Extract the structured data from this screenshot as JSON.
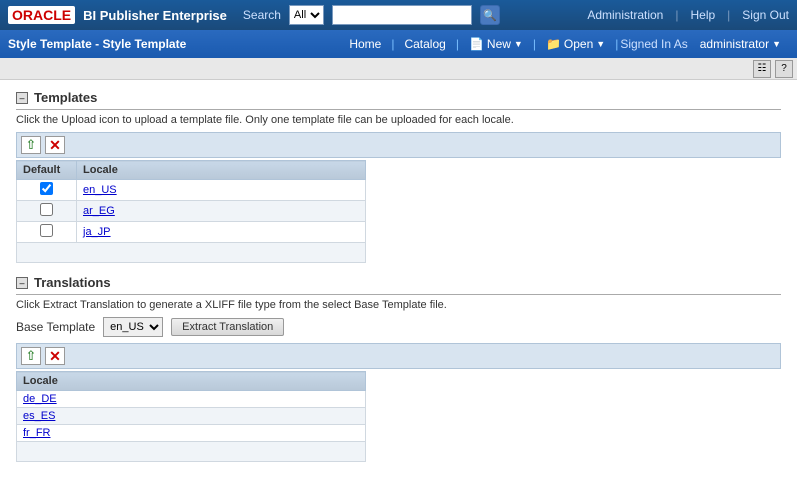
{
  "app": {
    "oracle_label": "ORACLE",
    "app_title": "BI Publisher Enterprise",
    "search_label": "Search",
    "search_value": "",
    "search_options": [
      "All"
    ],
    "search_selected": "All"
  },
  "top_nav": {
    "administration": "Administration",
    "help": "Help",
    "sign_out": "Sign Out"
  },
  "second_nav": {
    "page_title": "Style Template - Style Template",
    "home": "Home",
    "catalog": "Catalog",
    "new": "New",
    "open": "Open",
    "signed_in_as": "Signed In As",
    "username": "administrator"
  },
  "templates_section": {
    "title": "Templates",
    "description": "Click the Upload icon to upload a template file. Only one template file can be uploaded for each locale.",
    "columns": {
      "default": "Default",
      "locale": "Locale"
    },
    "rows": [
      {
        "default": true,
        "locale": "en_US",
        "checked": true
      },
      {
        "default": false,
        "locale": "ar_EG",
        "checked": false
      },
      {
        "default": false,
        "locale": "ja_JP",
        "checked": false
      }
    ]
  },
  "translations_section": {
    "title": "Translations",
    "description": "Click Extract Translation to generate a XLIFF file type from the select Base Template file.",
    "base_template_label": "Base Template",
    "base_template_value": "en_US",
    "base_template_options": [
      "en_US"
    ],
    "extract_btn_label": "Extract Translation",
    "column_locale": "Locale",
    "rows": [
      {
        "locale": "de_DE"
      },
      {
        "locale": "es_ES"
      },
      {
        "locale": "fr_FR"
      }
    ]
  }
}
